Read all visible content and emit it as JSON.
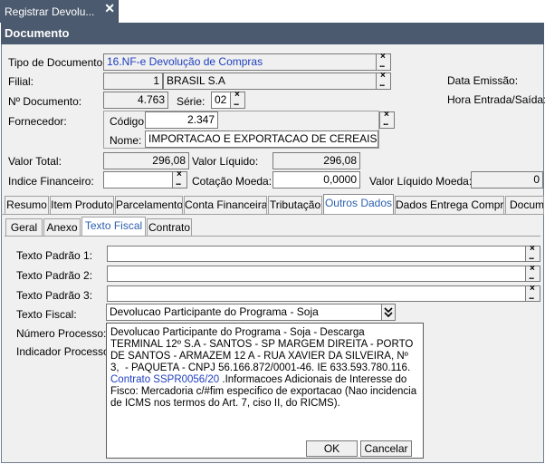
{
  "app_tab": {
    "title": "Registrar Devolu...",
    "close": "✕"
  },
  "window": {
    "title": "Documento"
  },
  "form": {
    "tipo_documento": {
      "label": "Tipo de Documento:",
      "value": "16.NF-e Devolução de Compras"
    },
    "filial": {
      "label": "Filial:",
      "code": "1",
      "name": "BRASIL S.A"
    },
    "data_emissao": {
      "label": "Data Emissão:"
    },
    "hora_entrada": {
      "label": "Hora Entrada/Saída:"
    },
    "n_documento": {
      "label": "Nº Documento:",
      "value": "4.763"
    },
    "serie": {
      "label": "Série:",
      "value": "02"
    },
    "fornecedor": {
      "label": "Fornecedor:",
      "codigo_label": "Código:",
      "codigo": "2.347",
      "nome_label": "Nome:",
      "nome": "IMPORTACAO E EXPORTACAO DE CEREAIS"
    },
    "valor_total": {
      "label": "Valor Total:",
      "value": "296,08"
    },
    "valor_liquido": {
      "label": "Valor Líquido:",
      "value": "296,08"
    },
    "indice_financeiro": {
      "label": "Indice Financeiro:",
      "value": ""
    },
    "cotacao_moeda": {
      "label": "Cotação Moeda:",
      "value": "0,0000"
    },
    "valor_liquido_moeda": {
      "label": "Valor Líquido Moeda:",
      "value": "0"
    }
  },
  "tabs": [
    "Resumo",
    "Item Produto",
    "Parcelamento",
    "Conta Financeira",
    "Tributação",
    "Outros Dados",
    "Dados Entrega Compra",
    "Docume"
  ],
  "subtabs": [
    "Geral",
    "Anexo",
    "Texto Fiscal",
    "Contrato"
  ],
  "texto": {
    "padrao1": "Texto Padrão 1:",
    "padrao2": "Texto Padrão 2:",
    "padrao3": "Texto Padrão 3:",
    "fiscal_label": "Texto Fiscal:",
    "fiscal_value": "Devolucao Participante do Programa - Soja",
    "numero_processo": "Número Processo:",
    "indicador_processo": "Indicador Processo:"
  },
  "popup": {
    "text_before": "Devolucao Participante do Programa - Soja - Descarga\nTERMINAL 12º S.A - SANTOS - SP MARGEM DIREITA - PORTO DE SANTOS - ARMAZEM 12 A - RUA XAVIER DA SILVEIRA, Nº 3,  - PAQUETA - CNPJ 56.166.872/0001-46. IE 633.593.780.116. ",
    "link": "Contrato SSPR0056/20",
    "text_after": " .Informacoes Adicionais de Interesse do Fisco: Mercadoria c/#fim especifico de exportacao (Nao incidencia de ICMS nos termos do Art. 7, ciso II, do RICMS).",
    "ok": "OK",
    "cancel": "Cancelar"
  },
  "icons": {
    "clear": "×",
    "lookup": "...",
    "dropdown": "chevron-down"
  }
}
